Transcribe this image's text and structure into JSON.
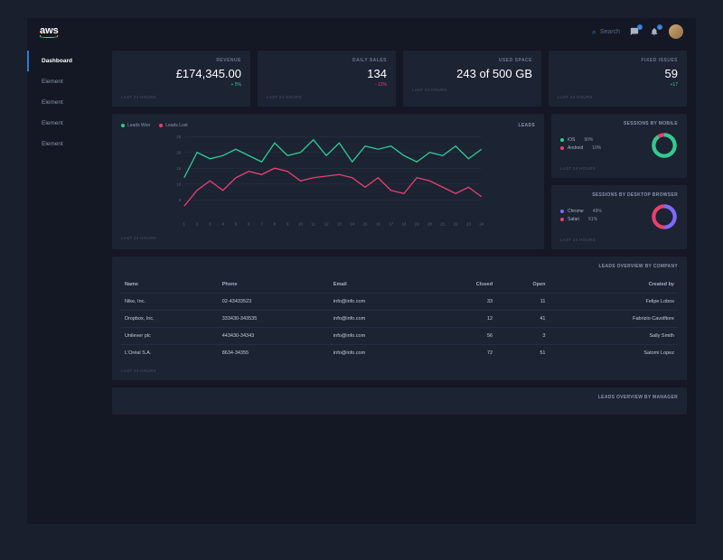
{
  "header": {
    "logo": "aws",
    "search_placeholder": "Search",
    "message_badge": "0",
    "notification_badge": "0"
  },
  "sidebar": {
    "items": [
      {
        "label": "Dashboard",
        "active": true
      },
      {
        "label": "Element",
        "active": false
      },
      {
        "label": "Element",
        "active": false
      },
      {
        "label": "Element",
        "active": false
      },
      {
        "label": "Element",
        "active": false
      }
    ]
  },
  "stats": [
    {
      "title": "REVENUE",
      "value": "£174,345.00",
      "delta": "+ 5%",
      "dir": "up",
      "footer": "LAST 24 HOURS"
    },
    {
      "title": "DAILY SALES",
      "value": "134",
      "delta": "- 12%",
      "dir": "down",
      "footer": "LAST 24 HOURS"
    },
    {
      "title": "USED SPACE",
      "value": "243 of 500 GB",
      "delta": "",
      "dir": "",
      "footer": "LAST 24 HOURS"
    },
    {
      "title": "FIXED ISSUES",
      "value": "59",
      "delta": "+17",
      "dir": "up",
      "footer": "LAST 24 HOURS"
    }
  ],
  "chart": {
    "title": "LEADS",
    "legend": [
      {
        "label": "Leads Won",
        "color": "#2ecc8f"
      },
      {
        "label": "Leads Lost",
        "color": "#e8416b"
      }
    ],
    "footer": "LAST 24 HOURS"
  },
  "chart_data": {
    "type": "line",
    "x": [
      1,
      2,
      3,
      4,
      5,
      6,
      7,
      8,
      9,
      10,
      11,
      12,
      13,
      14,
      15,
      16,
      17,
      18,
      19,
      20,
      21,
      22,
      23,
      24
    ],
    "ylim": [
      0,
      25
    ],
    "yticks": [
      5,
      10,
      15,
      20,
      25
    ],
    "series": [
      {
        "name": "Leads Won",
        "color": "#2ecc8f",
        "values": [
          12,
          20,
          18,
          19,
          21,
          19,
          17,
          23,
          19,
          20,
          24,
          19,
          23,
          17,
          22,
          21,
          22,
          19,
          17,
          20,
          19,
          22,
          18,
          21
        ]
      },
      {
        "name": "Leads Lost",
        "color": "#e8416b",
        "values": [
          3,
          8,
          11,
          8,
          12,
          14,
          13,
          15,
          14,
          11,
          12,
          12.5,
          13,
          12,
          9,
          12,
          8,
          7,
          12,
          11,
          9,
          7,
          9,
          6
        ]
      }
    ]
  },
  "sessions_mobile": {
    "title": "SESSIONS BY MOBILE",
    "items": [
      {
        "label": "iOS",
        "pct": "90%",
        "color": "#2ecc8f"
      },
      {
        "label": "Android",
        "pct": "10%",
        "color": "#e8416b"
      }
    ],
    "footer": "LAST 24 HOURS"
  },
  "sessions_browser": {
    "title": "SESSIONS BY DESKTOP BROWSER",
    "items": [
      {
        "label": "Chrome",
        "pct": "49%",
        "color": "#7b6cff"
      },
      {
        "label": "Safari",
        "pct": "51%",
        "color": "#e8416b"
      }
    ],
    "footer": "LAST 24 HOURS"
  },
  "table": {
    "title": "LEADS OVERVIEW BY COMPANY",
    "headers": [
      "Name",
      "Phone",
      "Email",
      "Closed",
      "Open",
      "Created by"
    ],
    "rows": [
      [
        "Nike, Inc.",
        "02-43433523",
        "info@info.com",
        "33",
        "11",
        "Felipe Lobos"
      ],
      [
        "Dropbox, Inc.",
        "333430-343535",
        "info@info.com",
        "12",
        "41",
        "Fabrizio Cavolfiore"
      ],
      [
        "Unilever plc",
        "443430-34343",
        "info@info.com",
        "56",
        "3",
        "Sally Smith"
      ],
      [
        "L'Oréal S.A.",
        "8634-34355",
        "info@info.com",
        "72",
        "51",
        "Satomi Lopez"
      ]
    ],
    "footer": "LAST 24 HOURS"
  },
  "section2": {
    "title": "LEADS OVERVIEW BY MANAGER"
  }
}
